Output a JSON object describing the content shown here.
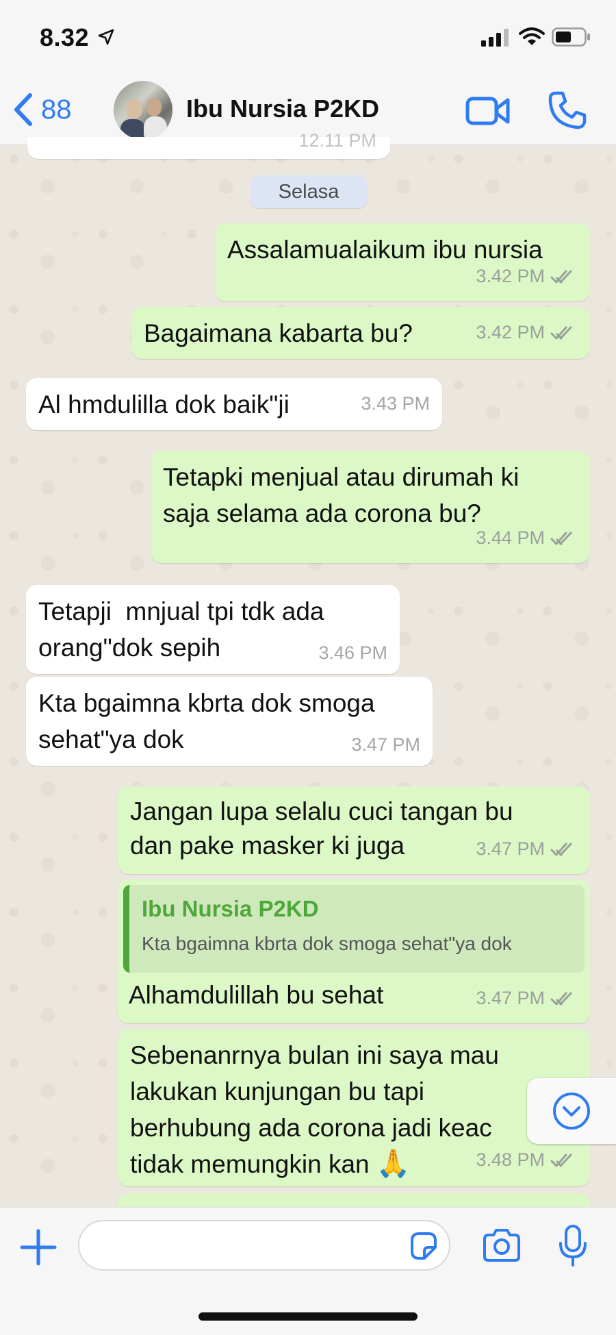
{
  "status_bar": {
    "time": "8.32"
  },
  "header": {
    "back_count": "88",
    "contact_name": "Ibu Nursia P2KD"
  },
  "chat": {
    "date_label": "Selasa",
    "previous_time": "12.11 PM",
    "messages": [
      {
        "dir": "out",
        "text": "Assalamualaikum ibu nursia",
        "time": "3.42 PM"
      },
      {
        "dir": "out",
        "text": "Bagaimana kabarta bu?",
        "time": "3.42 PM"
      },
      {
        "dir": "in",
        "text": "Al hmdulilla dok baik\"ji",
        "time": "3.43 PM"
      },
      {
        "dir": "out",
        "line1": "Tetapki menjual atau dirumah ki",
        "line2": "saja selama ada corona bu?",
        "time": "3.44 PM"
      },
      {
        "dir": "in",
        "line1": "Tetapji  mnjual tpi tdk ada",
        "line2": "orang\"dok sepih",
        "time": "3.46 PM"
      },
      {
        "dir": "in",
        "line1": "Kta bgaimna kbrta dok smoga",
        "line2": "sehat\"ya dok",
        "time": "3.47 PM"
      },
      {
        "dir": "out",
        "line1": "Jangan lupa selalu cuci tangan bu",
        "line2": "dan pake masker ki juga",
        "time": "3.47 PM"
      },
      {
        "dir": "out",
        "quote_name": "Ibu Nursia P2KD",
        "quote_text": "Kta bgaimna kbrta dok smoga sehat\"ya dok",
        "text": "Alhamdulillah bu sehat",
        "time": "3.47 PM"
      },
      {
        "dir": "out",
        "line1": "Sebenanrnya bulan ini saya mau",
        "line2": "lakukan kunjungan bu tapi",
        "line3": "berhubung ada corona jadi keac",
        "line4": "tidak memungkin kan",
        "emoji": "🙏",
        "time": "3.48 PM"
      }
    ]
  },
  "input": {
    "placeholder": ""
  },
  "colors": {
    "accent": "#2f7bf0",
    "outgoing_bubble": "#dcf8c6",
    "incoming_bubble": "#ffffff",
    "quote_accent": "#4ea73a"
  },
  "icons": {
    "status": [
      "location-arrow-icon",
      "signal-icon",
      "wifi-icon",
      "battery-icon"
    ],
    "header": [
      "back-chevron-icon",
      "video-call-icon",
      "phone-call-icon"
    ],
    "input": [
      "plus-icon",
      "sticker-icon",
      "camera-icon",
      "microphone-icon"
    ],
    "chat": [
      "double-check-icon",
      "chevron-down-circle-icon"
    ]
  }
}
